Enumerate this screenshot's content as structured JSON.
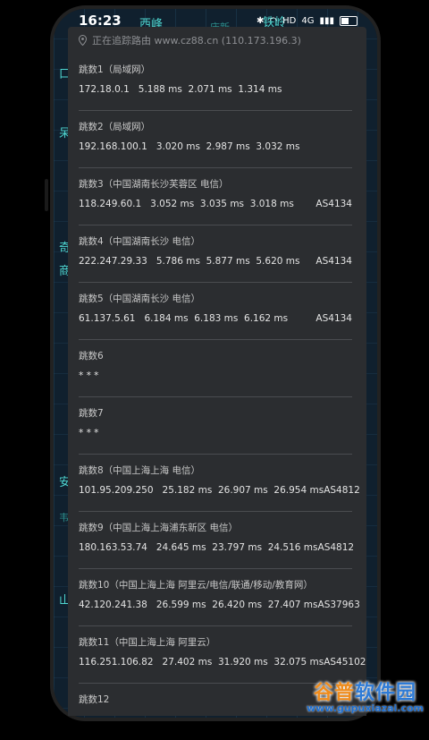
{
  "status_bar": {
    "time": "16:23",
    "signal_label": "4G",
    "battery_label": "HD"
  },
  "map": {
    "labels": [
      "西峰",
      "庆新",
      "铁岭",
      "口",
      "呆",
      "奇",
      "商",
      "安",
      "韦",
      "山"
    ]
  },
  "tracing": {
    "text": "正在追踪路由 www.cz88.cn (110.173.196.3)"
  },
  "hops": [
    {
      "title": "跳数1（局域网）",
      "addr": "172.18.0.1   5.188 ms  2.071 ms  1.314 ms",
      "as": ""
    },
    {
      "title": "跳数2（局域网）",
      "addr": "192.168.100.1   3.020 ms  2.987 ms  3.032 ms",
      "as": ""
    },
    {
      "title": "跳数3（中国湖南长沙芙蓉区 电信）",
      "addr": "118.249.60.1   3.052 ms  3.035 ms  3.018 ms",
      "as": "AS4134"
    },
    {
      "title": "跳数4（中国湖南长沙 电信）",
      "addr": "222.247.29.33   5.786 ms  5.877 ms  5.620 ms",
      "as": "AS4134"
    },
    {
      "title": "跳数5（中国湖南长沙 电信）",
      "addr": "61.137.5.61   6.184 ms  6.183 ms  6.162 ms",
      "as": "AS4134"
    },
    {
      "title": "跳数6",
      "addr": "* * *",
      "as": ""
    },
    {
      "title": "跳数7",
      "addr": "* * *",
      "as": ""
    },
    {
      "title": "跳数8（中国上海上海 电信）",
      "addr": "101.95.209.250   25.182 ms  26.907 ms  26.954 ms",
      "as": "AS4812"
    },
    {
      "title": "跳数9（中国上海上海浦东新区 电信）",
      "addr": "180.163.53.74   24.645 ms  23.797 ms  24.516 ms",
      "as": "AS4812"
    },
    {
      "title": "跳数10（中国上海上海 阿里云/电信/联通/移动/教育网）",
      "addr": "42.120.241.38   26.599 ms  26.420 ms  27.407 ms",
      "as": "AS37963"
    },
    {
      "title": "跳数11（中国上海上海 阿里云）",
      "addr": "116.251.106.82   27.402 ms  31.920 ms  32.075 ms",
      "as": "AS45102"
    },
    {
      "title": "跳数12",
      "addr": "",
      "as": ""
    }
  ],
  "watermark": {
    "logo_a": "谷普",
    "logo_b": "软件园",
    "url": "www.gupuxiazai.com"
  }
}
